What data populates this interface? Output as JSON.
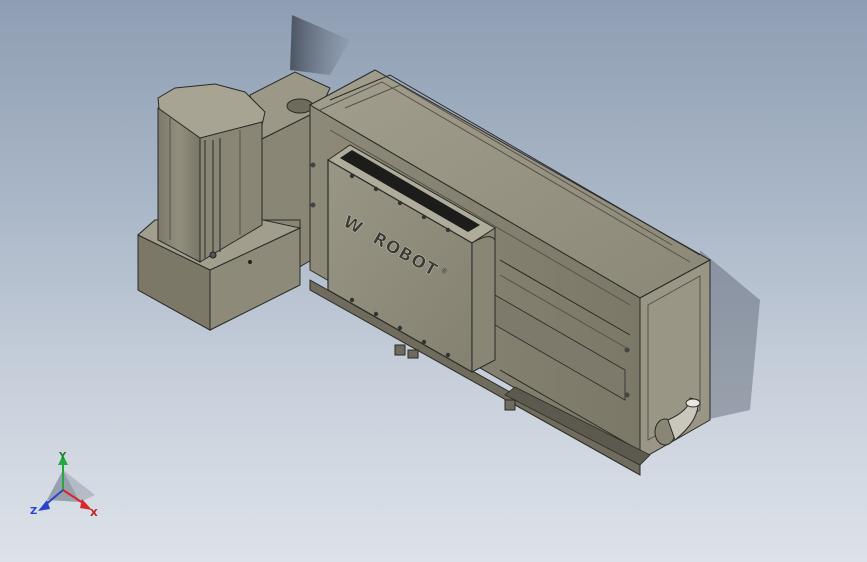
{
  "model": {
    "name": "linear-module-with-motor",
    "logo_text": "ROBOT",
    "logo_mark": "W",
    "registered_mark": "®"
  },
  "triad": {
    "x_label": "X",
    "y_label": "Y",
    "z_label": "Z"
  },
  "colors": {
    "background_top": "#8f9eb3",
    "background_bottom": "#dde2e9",
    "body": "#8a8676",
    "body_dark": "#6f6b5d",
    "edge": "#2a2a26",
    "x_axis": "#d8262a",
    "y_axis": "#25a83c",
    "z_axis": "#2a44c8"
  }
}
